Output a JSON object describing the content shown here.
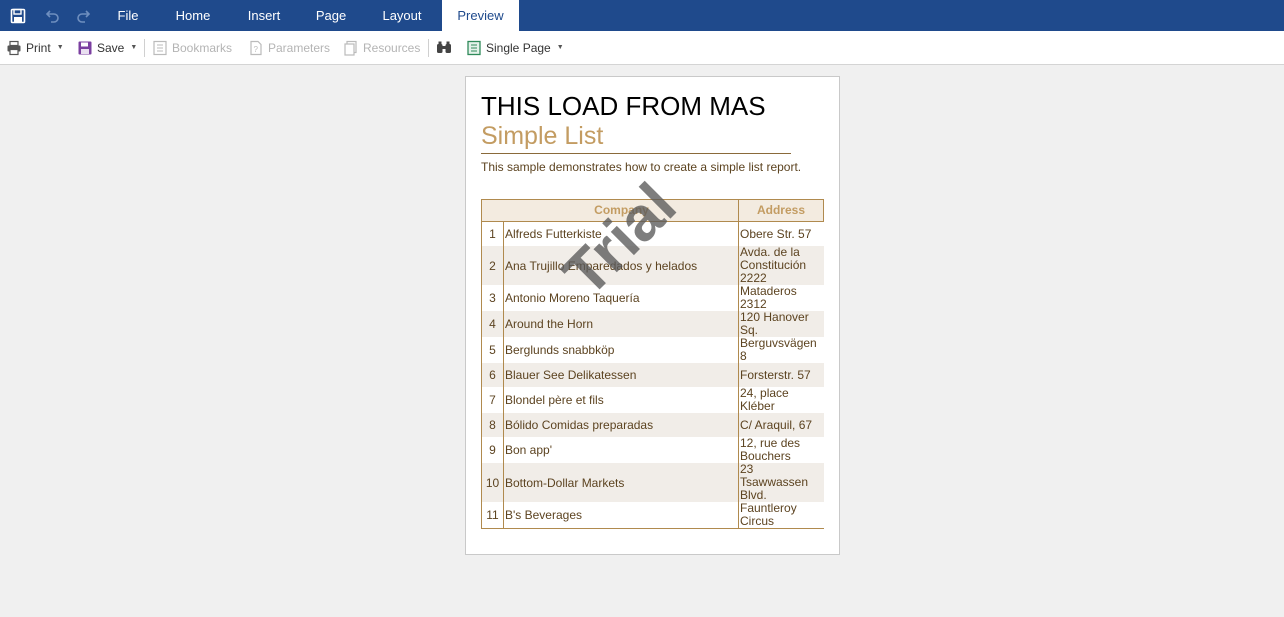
{
  "menu": {
    "tabs": [
      {
        "label": "File",
        "active": false
      },
      {
        "label": "Home",
        "active": false
      },
      {
        "label": "Insert",
        "active": false
      },
      {
        "label": "Page",
        "active": false
      },
      {
        "label": "Layout",
        "active": false
      },
      {
        "label": "Preview",
        "active": true
      }
    ],
    "quick_access_icons": [
      "save-icon",
      "undo-icon",
      "redo-icon"
    ]
  },
  "toolbar": {
    "print_label": "Print",
    "save_label": "Save",
    "bookmarks_label": "Bookmarks",
    "parameters_label": "Parameters",
    "resources_label": "Resources",
    "view_mode_label": "Single Page",
    "find_icon": "binoculars-icon"
  },
  "report": {
    "title": "THIS LOAD FROM MAS",
    "subtitle": "Simple List",
    "description": "This sample demonstrates how to create a simple list report.",
    "watermark": "Trial",
    "columns": {
      "company": "Company",
      "address": "Address"
    },
    "rows": [
      {
        "num": "1",
        "company": "Alfreds Futterkiste",
        "address": [
          "Obere Str. 57"
        ]
      },
      {
        "num": "2",
        "company": "Ana Trujillo Emparedados y helados",
        "address": [
          "Avda. de la",
          "Constitución",
          "2222"
        ]
      },
      {
        "num": "3",
        "company": "Antonio Moreno Taquería",
        "address": [
          "Mataderos",
          "2312"
        ]
      },
      {
        "num": "4",
        "company": "Around the Horn",
        "address": [
          "120 Hanover",
          "Sq."
        ]
      },
      {
        "num": "5",
        "company": "Berglunds snabbköp",
        "address": [
          "Berguvsvägen",
          "8"
        ]
      },
      {
        "num": "6",
        "company": "Blauer See Delikatessen",
        "address": [
          "Forsterstr. 57"
        ]
      },
      {
        "num": "7",
        "company": "Blondel père et fils",
        "address": [
          "24, place",
          "Kléber"
        ]
      },
      {
        "num": "8",
        "company": "Bólido Comidas preparadas",
        "address": [
          "C/ Araquil, 67"
        ]
      },
      {
        "num": "9",
        "company": "Bon app'",
        "address": [
          "12, rue des",
          "Bouchers"
        ]
      },
      {
        "num": "10",
        "company": "Bottom-Dollar Markets",
        "address": [
          "23",
          "Tsawwassen",
          "Blvd."
        ]
      },
      {
        "num": "11",
        "company": "B's Beverages",
        "address": [
          "Fauntleroy",
          "Circus"
        ]
      }
    ]
  },
  "colors": {
    "menu_bar": "#1f4a8c",
    "accent_gold": "#c39c62",
    "table_border": "#b08a4e",
    "alt_row": "#f1ede8"
  }
}
